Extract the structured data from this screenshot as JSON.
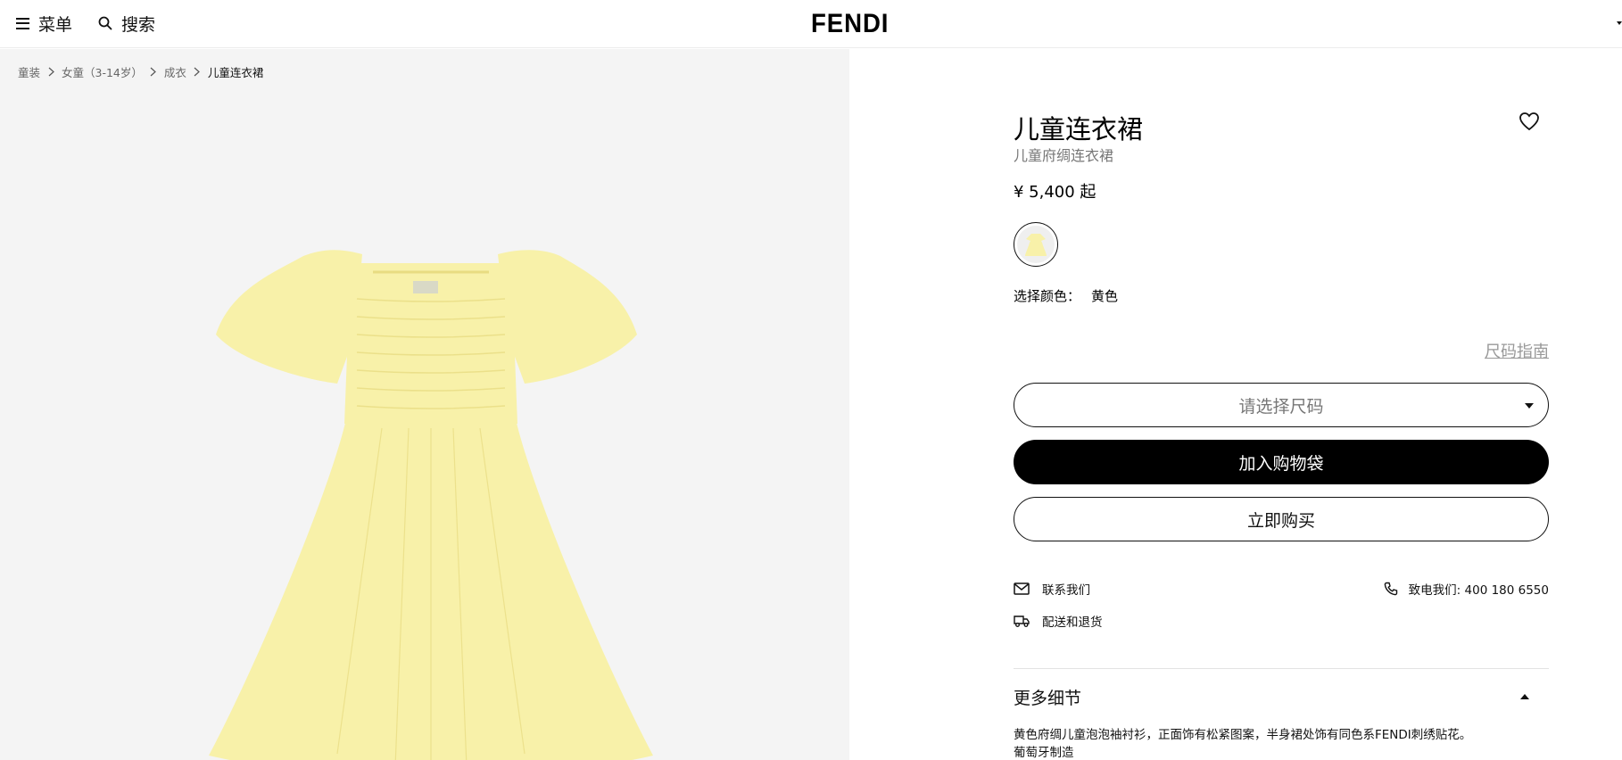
{
  "header": {
    "menu_label": "菜单",
    "search_label": "搜索",
    "logo": "FENDI"
  },
  "breadcrumb": [
    {
      "label": "童装"
    },
    {
      "label": "女童（3-14岁）"
    },
    {
      "label": "成衣"
    },
    {
      "label": "儿童连衣裙"
    }
  ],
  "product": {
    "title": "儿童连衣裙",
    "subtitle": "儿童府绸连衣裙",
    "price": "¥ 5,400 起",
    "color_label": "选择颜色：",
    "color_value": "黄色",
    "swatch_color": "#f7efa6",
    "size_guide": "尺码指南",
    "size_placeholder": "请选择尺码",
    "add_to_bag": "加入购物袋",
    "buy_now": "立即购买",
    "contact_us": "联系我们",
    "delivery_returns": "配送和退货",
    "call_us": "致电我们: 400 180 6550",
    "more_details": "更多细节",
    "description_1": "黄色府绸儿童泡泡袖衬衫，正面饰有松紧图案，半身裙处饰有同色系FENDI刺绣贴花。",
    "description_2": "葡萄牙制造"
  },
  "colors": {
    "dress_yellow": "#f8f1a9",
    "gallery_bg": "#f4f4f4"
  }
}
